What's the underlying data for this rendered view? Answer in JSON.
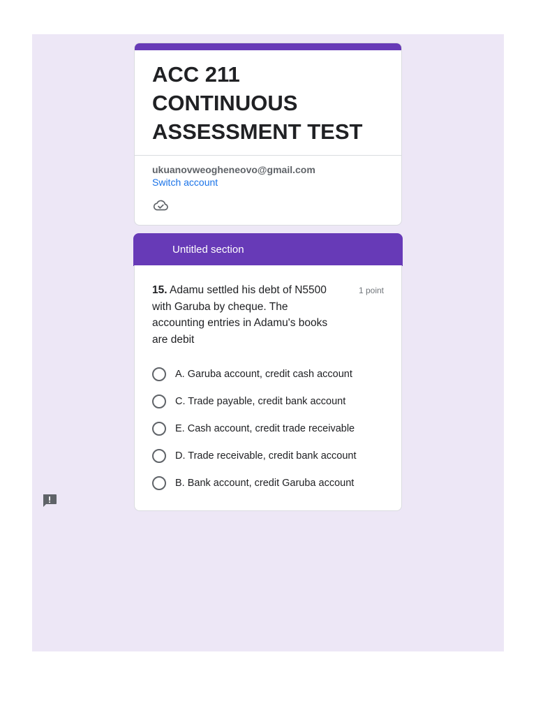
{
  "form": {
    "title": "ACC 211 CONTINUOUS ASSESSMENT TEST",
    "account_email": "ukuanovweogheneovo@gmail.com",
    "switch_account": "Switch account",
    "cloud_icon": "cloud-check-icon"
  },
  "section": {
    "title": "Untitled section"
  },
  "question": {
    "number": "15.",
    "text": " Adamu settled his debt of N5500 with Garuba by cheque. The accounting entries in Adamu's books are debit",
    "points": "1 point",
    "options": [
      {
        "label": "A. Garuba account, credit cash account"
      },
      {
        "label": "C. Trade payable, credit bank account"
      },
      {
        "label": "E. Cash account, credit trade receivable"
      },
      {
        "label": "D. Trade receivable, credit bank account"
      },
      {
        "label": "B. Bank account, credit Garuba account"
      }
    ]
  },
  "colors": {
    "accent": "#673ab7",
    "background": "#ede7f6",
    "link": "#1a73e8"
  },
  "feedback_icon": "report-feedback-icon"
}
